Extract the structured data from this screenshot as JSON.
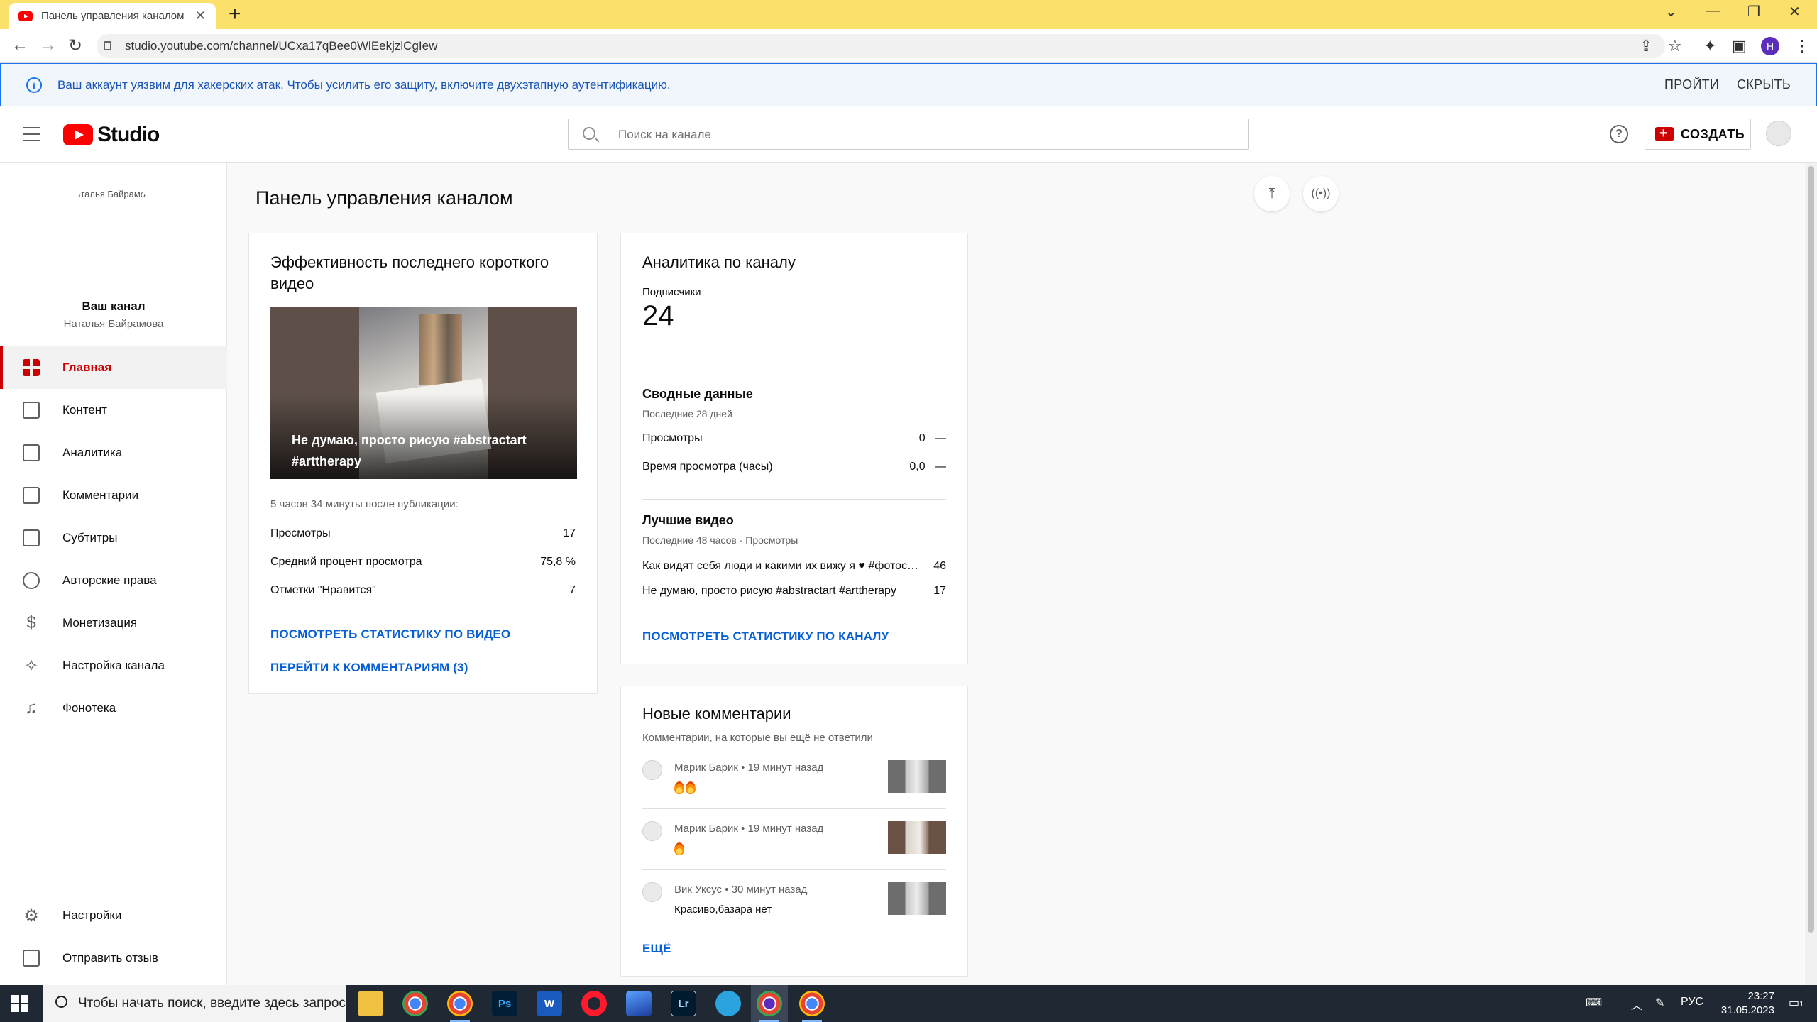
{
  "browser": {
    "tab_title": "Панель управления каналом - YouTube Studio",
    "new_tab": "+",
    "url": "studio.youtube.com/channel/UCxa17qBee0WlEekjzlCgIew",
    "profile_initial": "H",
    "infobar_text": "Ваш аккаунт уязвим для хакерских атак. Чтобы усилить его защиту, включите двухэтапную аутентификацию.",
    "infobar_go": "ПРОЙТИ",
    "infobar_hide": "СКРЫТЬ"
  },
  "header": {
    "logo_text": "Studio",
    "search_placeholder": "Поиск на канале",
    "create_label": "СОЗДАТЬ"
  },
  "sidebar": {
    "avatar_alt": "Наталья Байрамова",
    "your_channel": "Ваш канал",
    "channel_name": "Наталья Байрамова",
    "items": [
      {
        "label": "Главная",
        "icon": "dashboard-icon"
      },
      {
        "label": "Контент",
        "icon": "video-content-icon"
      },
      {
        "label": "Аналитика",
        "icon": "analytics-icon"
      },
      {
        "label": "Комментарии",
        "icon": "comments-icon"
      },
      {
        "label": "Субтитры",
        "icon": "subtitles-icon"
      },
      {
        "label": "Авторские права",
        "icon": "copyright-icon"
      },
      {
        "label": "Монетизация",
        "icon": "dollar-icon"
      },
      {
        "label": "Настройка канала",
        "icon": "magic-wand-icon"
      },
      {
        "label": "Фонотека",
        "icon": "audio-library-icon"
      }
    ],
    "bottom": [
      {
        "label": "Настройки",
        "icon": "gear-icon"
      },
      {
        "label": "Отправить отзыв",
        "icon": "feedback-icon"
      }
    ]
  },
  "main": {
    "page_title": "Панель управления каналом"
  },
  "latest_short": {
    "title": "Эффективность последнего короткого видео",
    "video_title": "Не думаю, просто рисую #abstractart #arttherapy",
    "since_published": "5 часов 34 минуты после публикации:",
    "stats": [
      {
        "label": "Просмотры",
        "value": "17"
      },
      {
        "label": "Средний процент просмотра",
        "value": "75,8 %"
      },
      {
        "label": "Отметки \"Нравится\"",
        "value": "7"
      }
    ],
    "link_stats": "ПОСМОТРЕТЬ СТАТИСТИКУ ПО ВИДЕО",
    "link_comments": "ПЕРЕЙТИ К КОММЕНТАРИЯМ (3)"
  },
  "analytics": {
    "title": "Аналитика по каналу",
    "subscribers_label": "Подписчики",
    "subscribers_value": "24",
    "summary_title": "Сводные данные",
    "summary_period": "Последние 28 дней",
    "summary_rows": [
      {
        "label": "Просмотры",
        "value": "0",
        "trend": "—"
      },
      {
        "label": "Время просмотра (часы)",
        "value": "0,0",
        "trend": "—"
      }
    ],
    "top_title": "Лучшие видео",
    "top_period": "Последние 48 часов · Просмотры",
    "top_rows": [
      {
        "label": "Как видят себя люди и какими их вижу я ♥ #фотос…",
        "value": "46"
      },
      {
        "label": "Не думаю, просто рисую #abstractart #arttherapy",
        "value": "17"
      }
    ],
    "link": "ПОСМОТРЕТЬ СТАТИСТИКУ ПО КАНАЛУ"
  },
  "comments": {
    "title": "Новые комментарии",
    "subtitle": "Комментарии, на которые вы ещё не ответили",
    "items": [
      {
        "author": "Марик Барик • 19 минут назад",
        "text": "🔥🔥"
      },
      {
        "author": "Марик Барик • 19 минут назад",
        "text": "🔥"
      },
      {
        "author": "Вик Уксус • 30 минут назад",
        "text": "Красиво,базара нет"
      }
    ],
    "more": "ЕЩЁ"
  },
  "taskbar": {
    "search_text": "Чтобы начать поиск, введите здесь запрос",
    "lang": "РУС",
    "time": "23:27",
    "date": "31.05.2023",
    "notifications": "1",
    "apps": [
      "Ps",
      "W",
      "Lr"
    ]
  }
}
